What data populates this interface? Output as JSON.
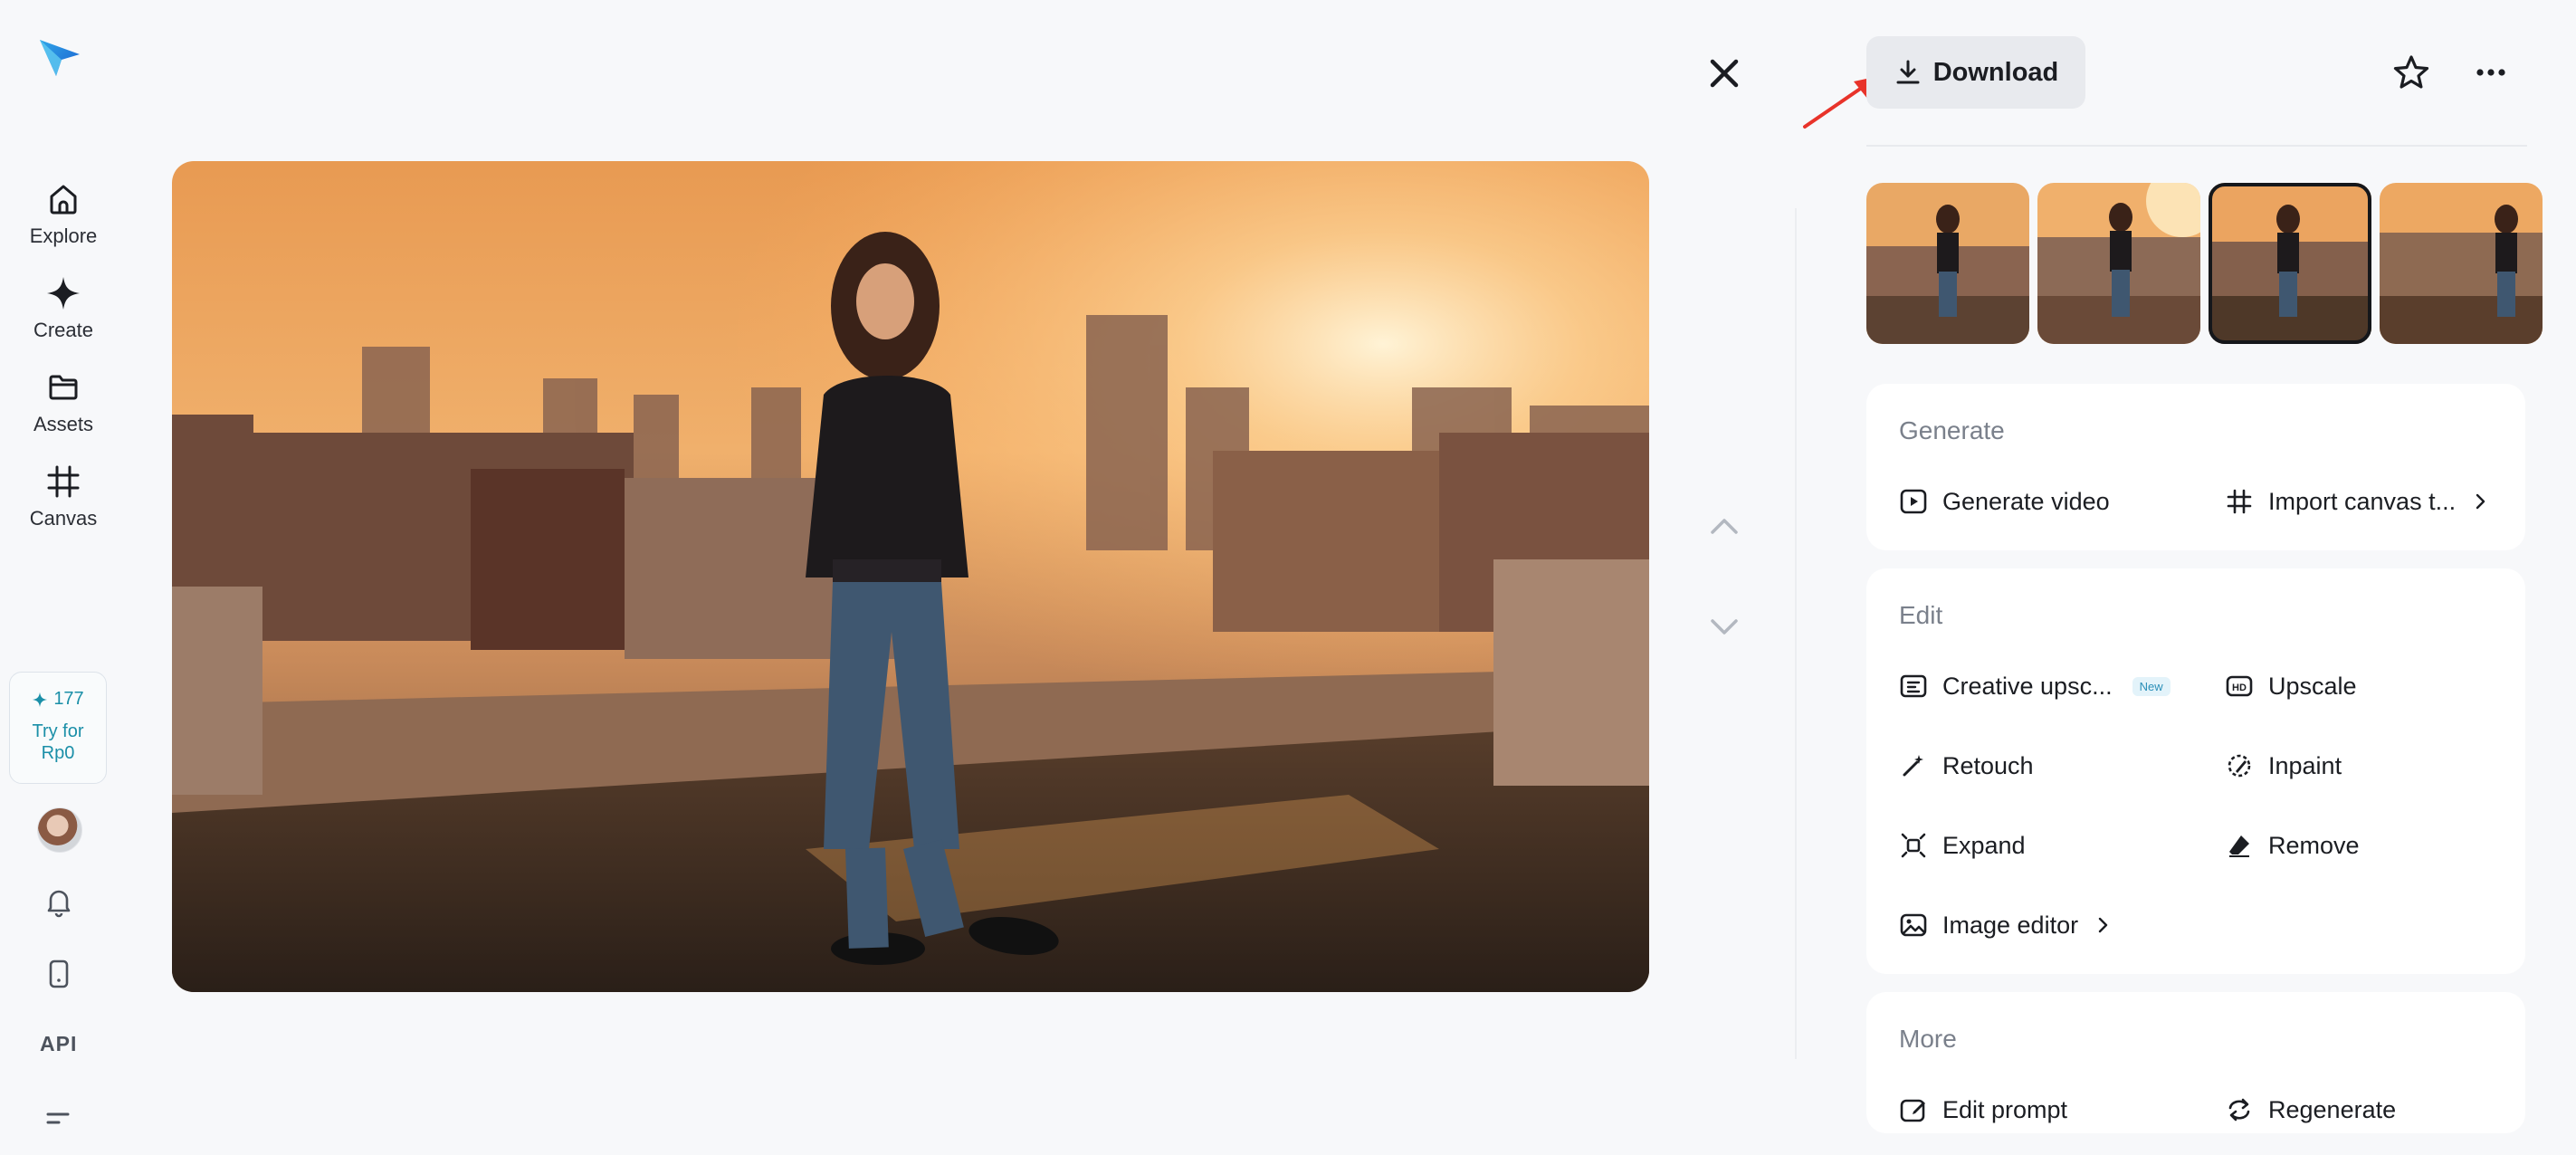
{
  "app": {
    "nav": [
      {
        "key": "explore",
        "label": "Explore",
        "icon": "home-icon"
      },
      {
        "key": "create",
        "label": "Create",
        "icon": "sparkle-icon"
      },
      {
        "key": "assets",
        "label": "Assets",
        "icon": "folder-icon"
      },
      {
        "key": "canvas",
        "label": "Canvas",
        "icon": "canvas-grid-icon"
      }
    ],
    "credits": {
      "count": "177",
      "try_label": "Try for Rp0"
    },
    "api_label": "API"
  },
  "toolbar": {
    "download_label": "Download"
  },
  "thumbnails": [
    {
      "name": "variation-1",
      "selected": false
    },
    {
      "name": "variation-2",
      "selected": false
    },
    {
      "name": "variation-3",
      "selected": true
    },
    {
      "name": "variation-4",
      "selected": false
    }
  ],
  "panel": {
    "generate": {
      "title": "Generate",
      "actions": [
        {
          "label": "Generate video",
          "icon": "play-icon"
        },
        {
          "label": "Import canvas t...",
          "icon": "canvas-grid-icon"
        }
      ]
    },
    "edit": {
      "title": "Edit",
      "actions": [
        {
          "label": "Creative upsc...",
          "icon": "creative-upscale-icon",
          "badge": "New"
        },
        {
          "label": "Upscale",
          "icon": "hd-icon"
        },
        {
          "label": "Retouch",
          "icon": "magic-wand-icon"
        },
        {
          "label": "Inpaint",
          "icon": "inpaint-icon"
        },
        {
          "label": "Expand",
          "icon": "expand-icon"
        },
        {
          "label": "Remove",
          "icon": "eraser-icon"
        },
        {
          "label": "Image editor",
          "icon": "image-editor-icon"
        }
      ]
    },
    "more": {
      "title": "More",
      "actions": [
        {
          "label": "Edit prompt",
          "icon": "edit-prompt-icon"
        },
        {
          "label": "Regenerate",
          "icon": "regenerate-icon"
        }
      ]
    }
  },
  "colors": {
    "accent_teal": "#1b8fa8",
    "selected_outline": "#15171b",
    "annotation_arrow": "#e8332a"
  }
}
